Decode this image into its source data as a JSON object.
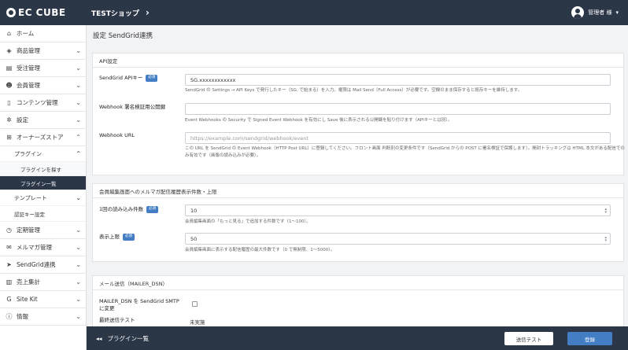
{
  "header": {
    "logo_text": "EC CUBE",
    "shop_name": "TESTショップ",
    "shop_chevron": "›",
    "user_name": "管理者 様",
    "user_chevron": "▾"
  },
  "sidebar": {
    "items": [
      {
        "label": "ホーム",
        "icon": "home-icon",
        "glyph": "⌂",
        "chevron": ""
      },
      {
        "label": "商品管理",
        "icon": "cube-icon",
        "glyph": "◈",
        "chevron": "⌄"
      },
      {
        "label": "受注管理",
        "icon": "cart-icon",
        "glyph": "▤",
        "chevron": "⌄"
      },
      {
        "label": "会員管理",
        "icon": "users-icon",
        "glyph": "☻",
        "chevron": "⌄"
      },
      {
        "label": "コンテンツ管理",
        "icon": "file-icon",
        "glyph": "▯",
        "chevron": "⌄"
      },
      {
        "label": "設定",
        "icon": "gear-icon",
        "glyph": "✲",
        "chevron": "⌄"
      },
      {
        "label": "オーナーズストア",
        "icon": "store-icon",
        "glyph": "⊞",
        "chevron": "⌃"
      }
    ],
    "plugin": {
      "label": "プラグイン",
      "chevron": "⌃"
    },
    "plugin_search": "プラグインを探す",
    "plugin_list": "プラグイン一覧",
    "template": {
      "label": "テンプレート",
      "chevron": "⌄"
    },
    "auth_key": "認証キー設定",
    "items2": [
      {
        "label": "定期管理",
        "icon": "clock-icon",
        "glyph": "◷",
        "chevron": "⌄"
      },
      {
        "label": "メルマガ管理",
        "icon": "mail-icon",
        "glyph": "✉",
        "chevron": "⌄"
      },
      {
        "label": "SendGrid連携",
        "icon": "send-icon",
        "glyph": "➤",
        "chevron": "⌄"
      },
      {
        "label": "売上集計",
        "icon": "chart-icon",
        "glyph": "▥",
        "chevron": "⌄"
      },
      {
        "label": "Site Kit",
        "icon": "google-icon",
        "glyph": "G",
        "chevron": "⌄"
      },
      {
        "label": "情報",
        "icon": "info-icon",
        "glyph": "ⓘ",
        "chevron": "⌄"
      }
    ]
  },
  "page": {
    "title": "設定 SendGrid連携"
  },
  "api": {
    "heading": "API設定",
    "apikey_label": "SendGrid APIキー",
    "required": "必須",
    "apikey_value": "SG.xxxxxxxxxxxx",
    "apikey_help": "SendGrid の Settings → API Keys で発行したキー（SG. で始まる）を入力。権限は Mail Send（Full Access）が必要です。空欄のまま保存すると既存キーを維持します。",
    "webhook_key_label": "Webhook 署名検証用公開鍵",
    "webhook_key_help": "Event Webhooks の Security で Signed Event Webhook を有効にし Save 後に表示される公開鍵を貼り付けます（APIキーとは別）。",
    "webhook_url_label": "Webhook URL",
    "webhook_url_value": "https://example.com/sendgrid/webhook/event",
    "webhook_url_help": "この URL を SendGrid の Event Webhook（HTTP Post URL）に登録してください。フロント画面 判断別の変更条件です（SendGrid からの POST に署名検証で保護します）。開封トラッキングは HTML 本文がある配信でのみ有効です（画像の読み込みが必要）。"
  },
  "members": {
    "heading": "会員編集画面へのメルマガ配信履歴表示件数・上限",
    "load_label": "1回の読み込み件数",
    "required": "必須",
    "load_value": "10",
    "load_help": "会員編集画面の「もっと見る」で追加する件数です（1〜100）。",
    "max_label": "表示上限",
    "max_value": "50",
    "max_help": "会員編集画面に表示する配信履歴の最大件数です（0 で無制限、1〜5000）。"
  },
  "mailer": {
    "heading": "メール送信（MAILER_DSN）",
    "dsn_label": "MAILER_DSN を SendGrid SMTP に変更",
    "last_test_label": "最終送信テスト",
    "last_test_value": "未実施"
  },
  "footer": {
    "back_label": "プラグイン一覧",
    "back_glyph": "◂◂",
    "test_button": "送信テスト",
    "save_button": "登録"
  }
}
